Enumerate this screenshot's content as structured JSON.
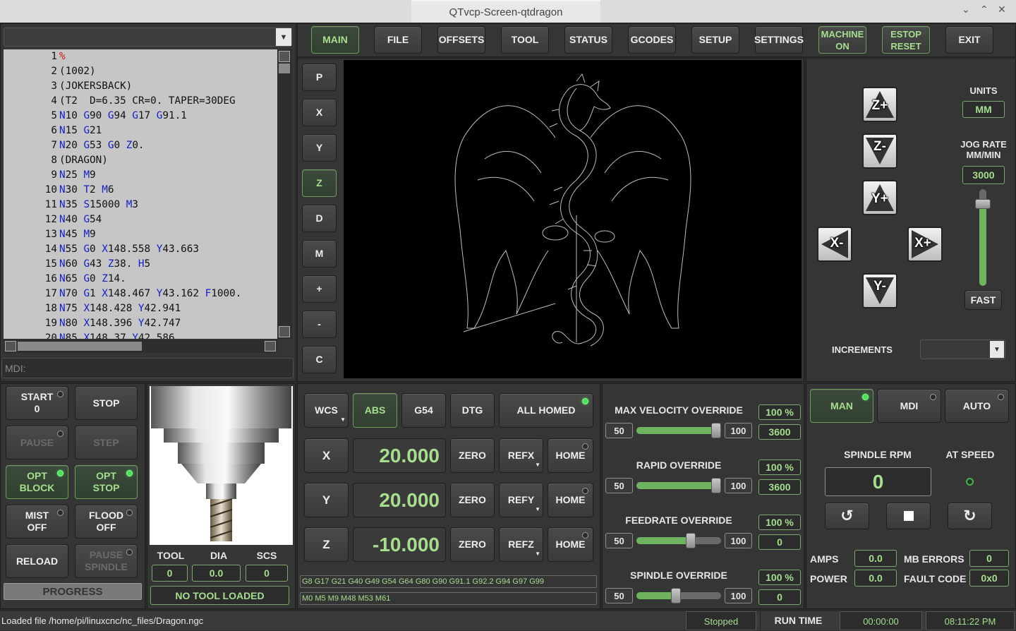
{
  "window": {
    "title": "QTvcp-Screen-qtdragon",
    "controls": [
      "⌄",
      "⌃",
      "✕"
    ]
  },
  "top_tabs": [
    {
      "label": "MAIN",
      "active": true
    },
    {
      "label": "FILE"
    },
    {
      "label": "OFFSETS"
    },
    {
      "label": "TOOL"
    },
    {
      "label": "STATUS"
    },
    {
      "label": "GCODES"
    },
    {
      "label": "SETUP"
    },
    {
      "label": "SETTINGS"
    },
    {
      "label": "MACHINE\nON",
      "green": true
    },
    {
      "label": "ESTOP\nRESET",
      "green": true
    },
    {
      "label": "EXIT"
    }
  ],
  "file_combo": {
    "placeholder": ""
  },
  "gcode_lines": [
    {
      "n": "1",
      "t": "%"
    },
    {
      "n": "2",
      "t": "(1002)"
    },
    {
      "n": "3",
      "t": "(JOKERSBACK)"
    },
    {
      "n": "4",
      "t": "(T2  D=6.35 CR=0. TAPER=30DEG"
    },
    {
      "n": "5",
      "t": "N10 G90 G94 G17 G91.1"
    },
    {
      "n": "6",
      "t": "N15 G21"
    },
    {
      "n": "7",
      "t": "N20 G53 G0 Z0."
    },
    {
      "n": "8",
      "t": "(DRAGON)"
    },
    {
      "n": "9",
      "t": "N25 M9"
    },
    {
      "n": "10",
      "t": "N30 T2 M6"
    },
    {
      "n": "11",
      "t": "N35 S15000 M3"
    },
    {
      "n": "12",
      "t": "N40 G54"
    },
    {
      "n": "13",
      "t": "N45 M9"
    },
    {
      "n": "14",
      "t": "N55 G0 X148.558 Y43.663"
    },
    {
      "n": "15",
      "t": "N60 G43 Z38. H5"
    },
    {
      "n": "16",
      "t": "N65 G0 Z14."
    },
    {
      "n": "17",
      "t": "N70 G1 X148.467 Y43.162 F1000."
    },
    {
      "n": "18",
      "t": "N75 X148.428 Y42.941"
    },
    {
      "n": "19",
      "t": "N80 X148.396 Y42.747"
    },
    {
      "n": "20",
      "t": "N85 X148.37 Y42.586"
    }
  ],
  "mdi": {
    "label": "MDI:"
  },
  "view_buttons": [
    "P",
    "X",
    "Y",
    "Z",
    "D",
    "M",
    "+",
    "-",
    "C"
  ],
  "view_active": "Z",
  "jog": {
    "units_label": "UNITS",
    "units_value": "MM",
    "rate_label": "JOG RATE\nMM/MIN",
    "rate_value": "3000",
    "fast_label": "FAST",
    "increments_label": "INCREMENTS",
    "slider_level": 0.85,
    "buttons": {
      "zp": "Z+",
      "zm": "Z-",
      "yp": "Y+",
      "ym": "Y-",
      "xm": "X-",
      "xp": "X+"
    }
  },
  "control_buttons": {
    "start": "START\n0",
    "stop": "STOP",
    "pause": "PAUSE",
    "step": "STEP",
    "opt_block": "OPT\nBLOCK",
    "opt_stop": "OPT\nSTOP",
    "mist": "MIST\nOFF",
    "flood": "FLOOD\nOFF",
    "reload": "RELOAD",
    "pause_spindle": "PAUSE\nSPINDLE",
    "progress": "PROGRESS"
  },
  "tool": {
    "tool_label": "TOOL",
    "dia_label": "DIA",
    "scs_label": "SCS",
    "tool_value": "0",
    "dia_value": "0.0",
    "scs_value": "0",
    "status": "NO TOOL LOADED"
  },
  "dro": {
    "wcs": "WCS",
    "abs": "ABS",
    "g54": "G54",
    "dtg": "DTG",
    "all_homed": "ALL HOMED",
    "axes": [
      {
        "axis": "X",
        "value": "20.000",
        "zero": "ZERO",
        "ref": "REFX",
        "home": "HOME"
      },
      {
        "axis": "Y",
        "value": "20.000",
        "zero": "ZERO",
        "ref": "REFY",
        "home": "HOME"
      },
      {
        "axis": "Z",
        "value": "-10.000",
        "zero": "ZERO",
        "ref": "REFZ",
        "home": "HOME"
      }
    ],
    "gcodes_active": "G8 G17 G21 G40 G49 G54 G64 G80 G90 G91.1 G92.2 G94 G97 G99",
    "mcodes_active": "M0 M5 M9 M48 M53 M61"
  },
  "overrides": [
    {
      "title": "MAX VELOCITY OVERRIDE",
      "min": "50",
      "max": "100",
      "percent": "100 %",
      "value": "3600",
      "level": 100
    },
    {
      "title": "RAPID OVERRIDE",
      "min": "50",
      "max": "100",
      "percent": "100 %",
      "value": "3600",
      "level": 100
    },
    {
      "title": "FEEDRATE OVERRIDE",
      "min": "50",
      "max": "100",
      "percent": "100 %",
      "value": "0",
      "level": 83
    },
    {
      "title": "SPINDLE OVERRIDE",
      "min": "50",
      "max": "100",
      "percent": "100 %",
      "value": "0",
      "level": 73
    }
  ],
  "mode": {
    "man": "MAN",
    "mdi": "MDI",
    "auto": "AUTO",
    "spindle_rpm_label": "SPINDLE RPM",
    "spindle_rpm": "0",
    "at_speed_label": "AT SPEED",
    "amps_label": "AMPS",
    "amps": "0.0",
    "mb_errors_label": "MB ERRORS",
    "mb_errors": "0",
    "power_label": "POWER",
    "power": "0.0",
    "fault_label": "FAULT CODE",
    "fault": "0x0"
  },
  "status": {
    "message": "Loaded file /home/pi/linuxcnc/nc_files/Dragon.ngc",
    "state": "Stopped",
    "run_time_label": "RUN TIME",
    "run_time": "00:00:00",
    "clock": "08:11:22 PM"
  },
  "colors": {
    "accent_green": "#a5df8e",
    "led_green": "#48e05a",
    "code_keyword": "#1420c8"
  }
}
